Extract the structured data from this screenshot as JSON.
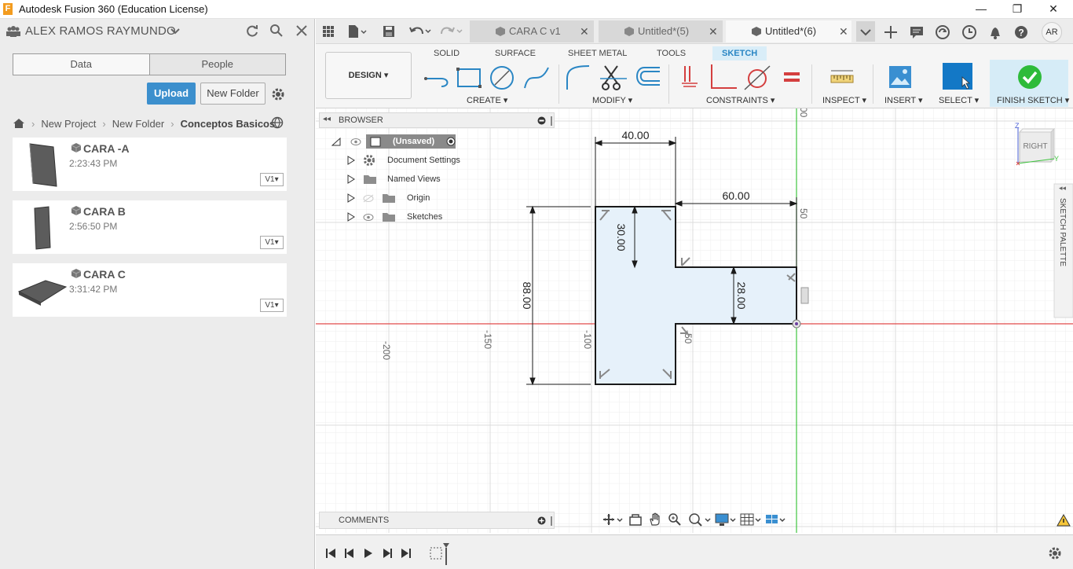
{
  "window": {
    "title": "Autodesk Fusion 360 (Education License)",
    "app_letter": "F",
    "minimize": "—",
    "maximize": "❐",
    "close": "✕"
  },
  "data_panel": {
    "user": "ALEX RAMOS RAYMUNDO",
    "tabs": [
      "Data",
      "People"
    ],
    "upload_label": "Upload",
    "new_folder_label": "New Folder",
    "breadcrumb": [
      "New Project",
      "New Folder",
      "Conceptos Basicos"
    ],
    "files": [
      {
        "name": "CARA -A",
        "time": "2:23:43 PM",
        "version": "V1▾"
      },
      {
        "name": "CARA B",
        "time": "2:56:50 PM",
        "version": "V1▾"
      },
      {
        "name": "CARA C",
        "time": "3:31:42 PM",
        "version": "V1▾"
      }
    ]
  },
  "doc_tabs": [
    {
      "label": "CARA C v1",
      "active": false
    },
    {
      "label": "Untitled*(5)",
      "active": false
    },
    {
      "label": "Untitled*(6)",
      "active": true
    }
  ],
  "user_initials": "AR",
  "ribbon": {
    "tabs": [
      "SOLID",
      "SURFACE",
      "SHEET METAL",
      "TOOLS",
      "SKETCH"
    ],
    "active_tab": "SKETCH",
    "workspace": "DESIGN ▾",
    "groups": [
      "CREATE ▾",
      "MODIFY ▾",
      "CONSTRAINTS ▾",
      "INSPECT ▾",
      "INSERT ▾",
      "SELECT ▾",
      "FINISH SKETCH ▾"
    ]
  },
  "browser": {
    "title": "BROWSER",
    "root": "(Unsaved)",
    "items": [
      "Document Settings",
      "Named Views",
      "Origin",
      "Sketches"
    ]
  },
  "comments_label": "COMMENTS",
  "viewcube": {
    "face": "RIGHT",
    "axis_z": "Z",
    "axis_y": "Y"
  },
  "sketch": {
    "sketch_palette": "SKETCH PALETTE",
    "dimensions": [
      "40.00",
      "60.00",
      "30.00",
      "28.00",
      "88.00"
    ],
    "axis_labels": [
      "-200",
      "-150",
      "-100",
      "-50",
      "50",
      "00"
    ]
  },
  "colors": {
    "accent": "#3c8fcd",
    "sketch_fill": "#e6f1fa",
    "x_axis": "#e04a4a",
    "y_axis": "#3ec43e",
    "finish_green": "#2ebb3a"
  }
}
